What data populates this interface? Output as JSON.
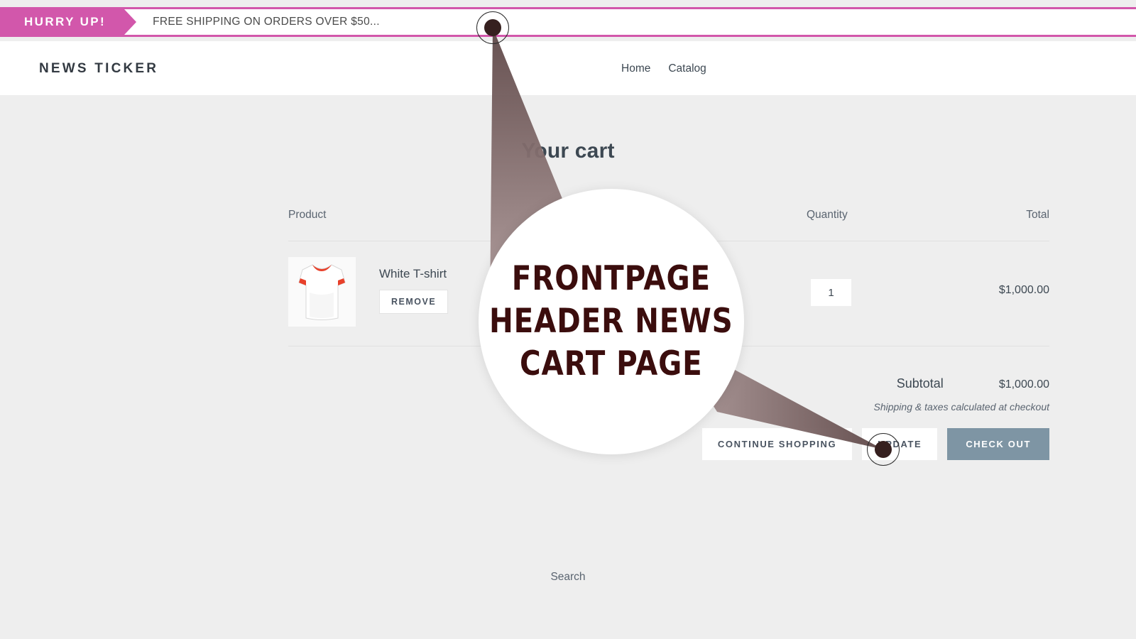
{
  "announcement": {
    "badge_label": "HURRY UP!",
    "message": "FREE SHIPPING ON ORDERS OVER $50...",
    "accent_color": "#d257ab"
  },
  "header": {
    "brand": "NEWS TICKER",
    "nav": [
      {
        "label": "Home"
      },
      {
        "label": "Catalog"
      }
    ]
  },
  "cart": {
    "title": "Your cart",
    "columns": {
      "product": "Product",
      "quantity": "Quantity",
      "total": "Total"
    },
    "items": [
      {
        "name": "White T-shirt",
        "remove_label": "REMOVE",
        "quantity": "1",
        "total": "$1,000.00",
        "image_name": "white-tshirt-thumbnail"
      }
    ],
    "subtotal_label": "Subtotal",
    "subtotal_value": "$1,000.00",
    "shipping_note": "Shipping & taxes calculated at checkout",
    "actions": {
      "continue_shopping": "CONTINUE SHOPPING",
      "update": "UPDATE",
      "check_out": "CHECK OUT",
      "checkout_color": "#7e95a4"
    }
  },
  "footer": {
    "search_label": "Search"
  },
  "annotation": {
    "magnifier_lines": [
      "FRONTPAGE",
      "HEADER NEWS",
      "CART PAGE"
    ],
    "text_color": "#3b0d0d",
    "callout_color": "#8a7373"
  }
}
